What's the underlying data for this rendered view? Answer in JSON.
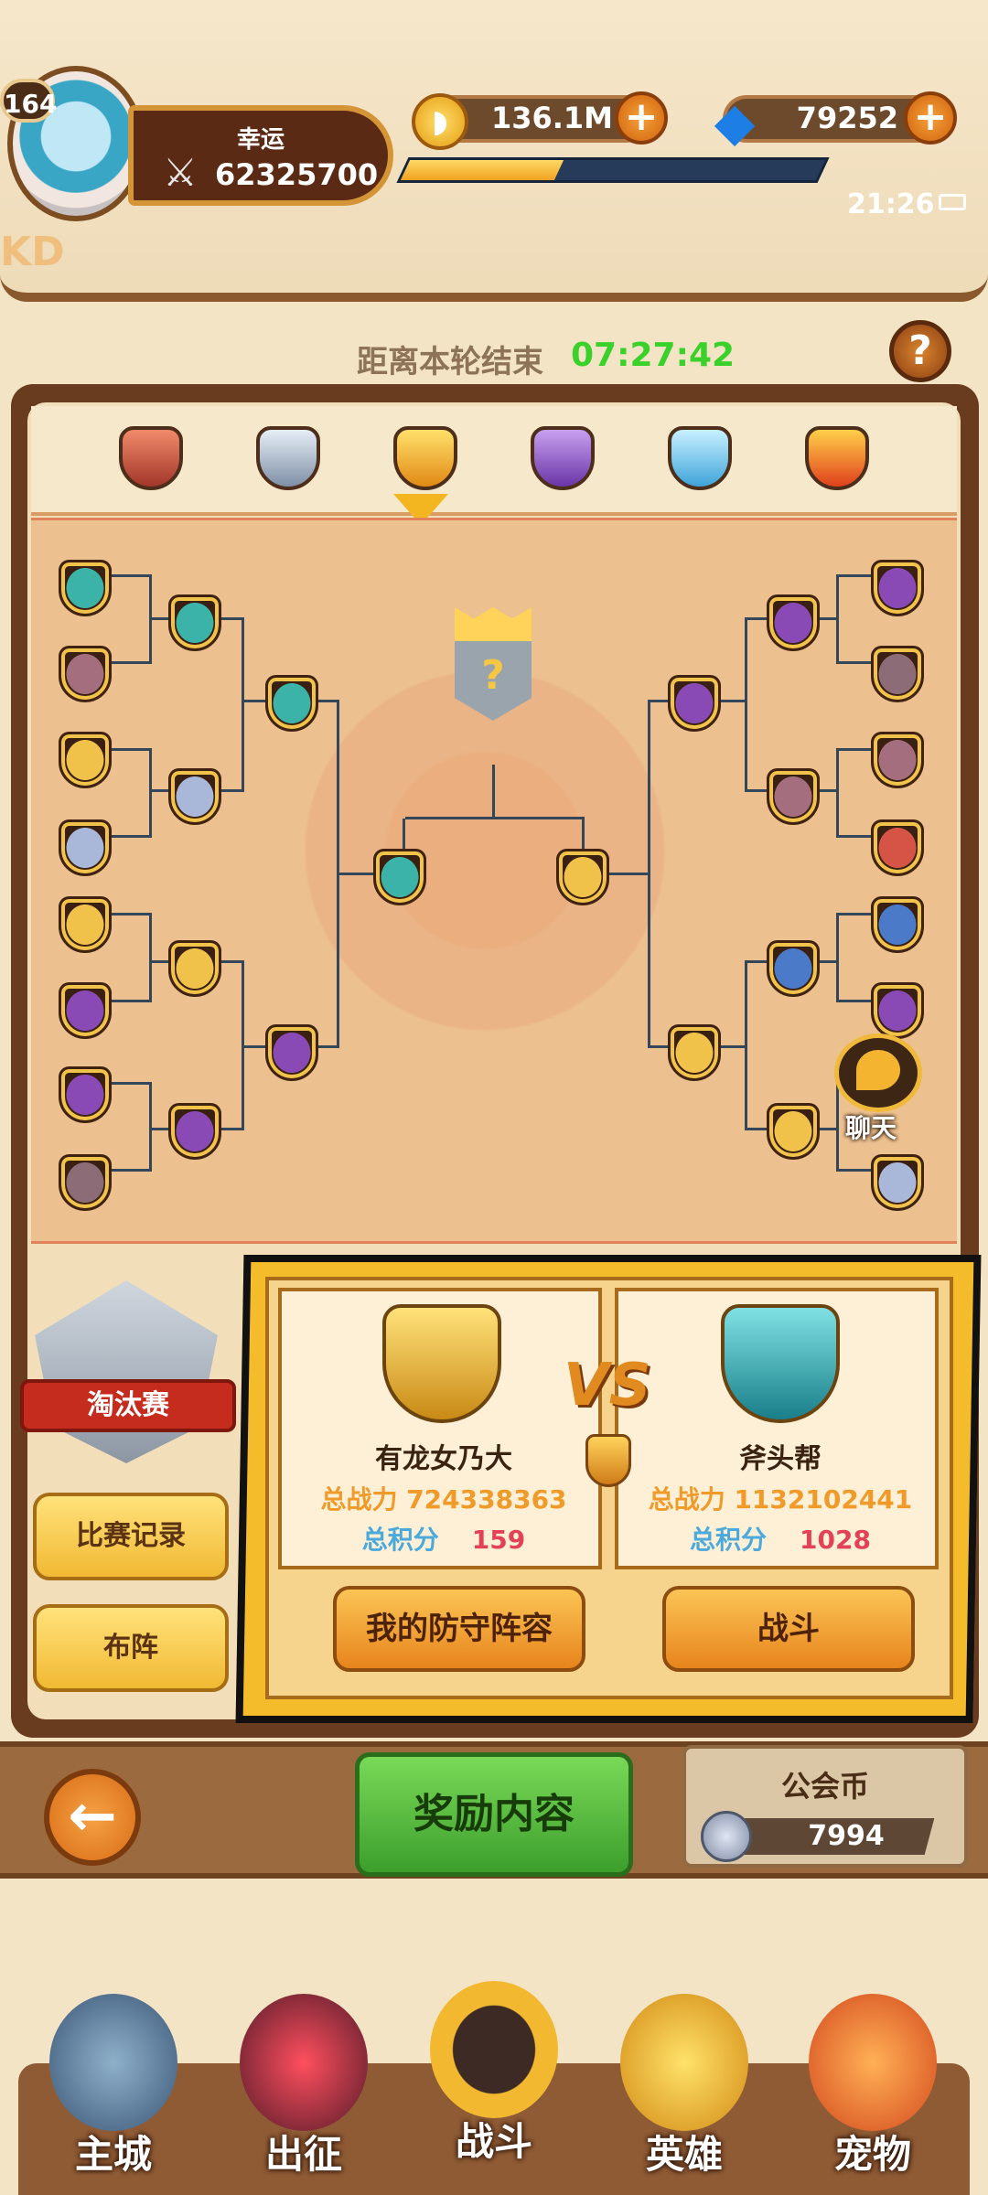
{
  "header": {
    "player_level": "164",
    "player_title": "幸运",
    "combat_power": "62325700",
    "gold": "136.1M",
    "gems": "79252",
    "exp_progress": 0.37,
    "clock": "21:26",
    "corner_text": "KD"
  },
  "timer": {
    "label": "距离本轮结束",
    "value": "07:27:42"
  },
  "tiers": [
    "bronze",
    "silver",
    "gold",
    "purple",
    "diamond",
    "legend"
  ],
  "bracket": {
    "chat_label": "聊天"
  },
  "sidebar": {
    "badge_label": "淘汰赛",
    "record_button": "比赛记录",
    "formation_button": "布阵"
  },
  "match": {
    "vs_text": "VS",
    "team_left": {
      "name": "有龙女乃大",
      "power_label": "总战力 724338363",
      "score_label": "总积分",
      "score_value": "159"
    },
    "team_right": {
      "name": "斧头帮",
      "power_label": "总战力 1132102441",
      "score_label": "总积分",
      "score_value": "1028"
    },
    "defense_button": "我的防守阵容",
    "battle_button": "战斗"
  },
  "bottom": {
    "reward_button": "奖励内容",
    "guild_coin_label": "公会币",
    "guild_coin_value": "7994"
  },
  "nav": [
    {
      "label": "主城",
      "icon": "castle-icon"
    },
    {
      "label": "出征",
      "icon": "expedition-icon"
    },
    {
      "label": "战斗",
      "icon": "battle-icon"
    },
    {
      "label": "英雄",
      "icon": "hero-icon"
    },
    {
      "label": "宠物",
      "icon": "pet-icon"
    }
  ],
  "colors": {
    "timer_green": "#3ad12b",
    "power_orange": "#f09a2a",
    "score_blue": "#4ba9dc",
    "score_red": "#e34155"
  }
}
